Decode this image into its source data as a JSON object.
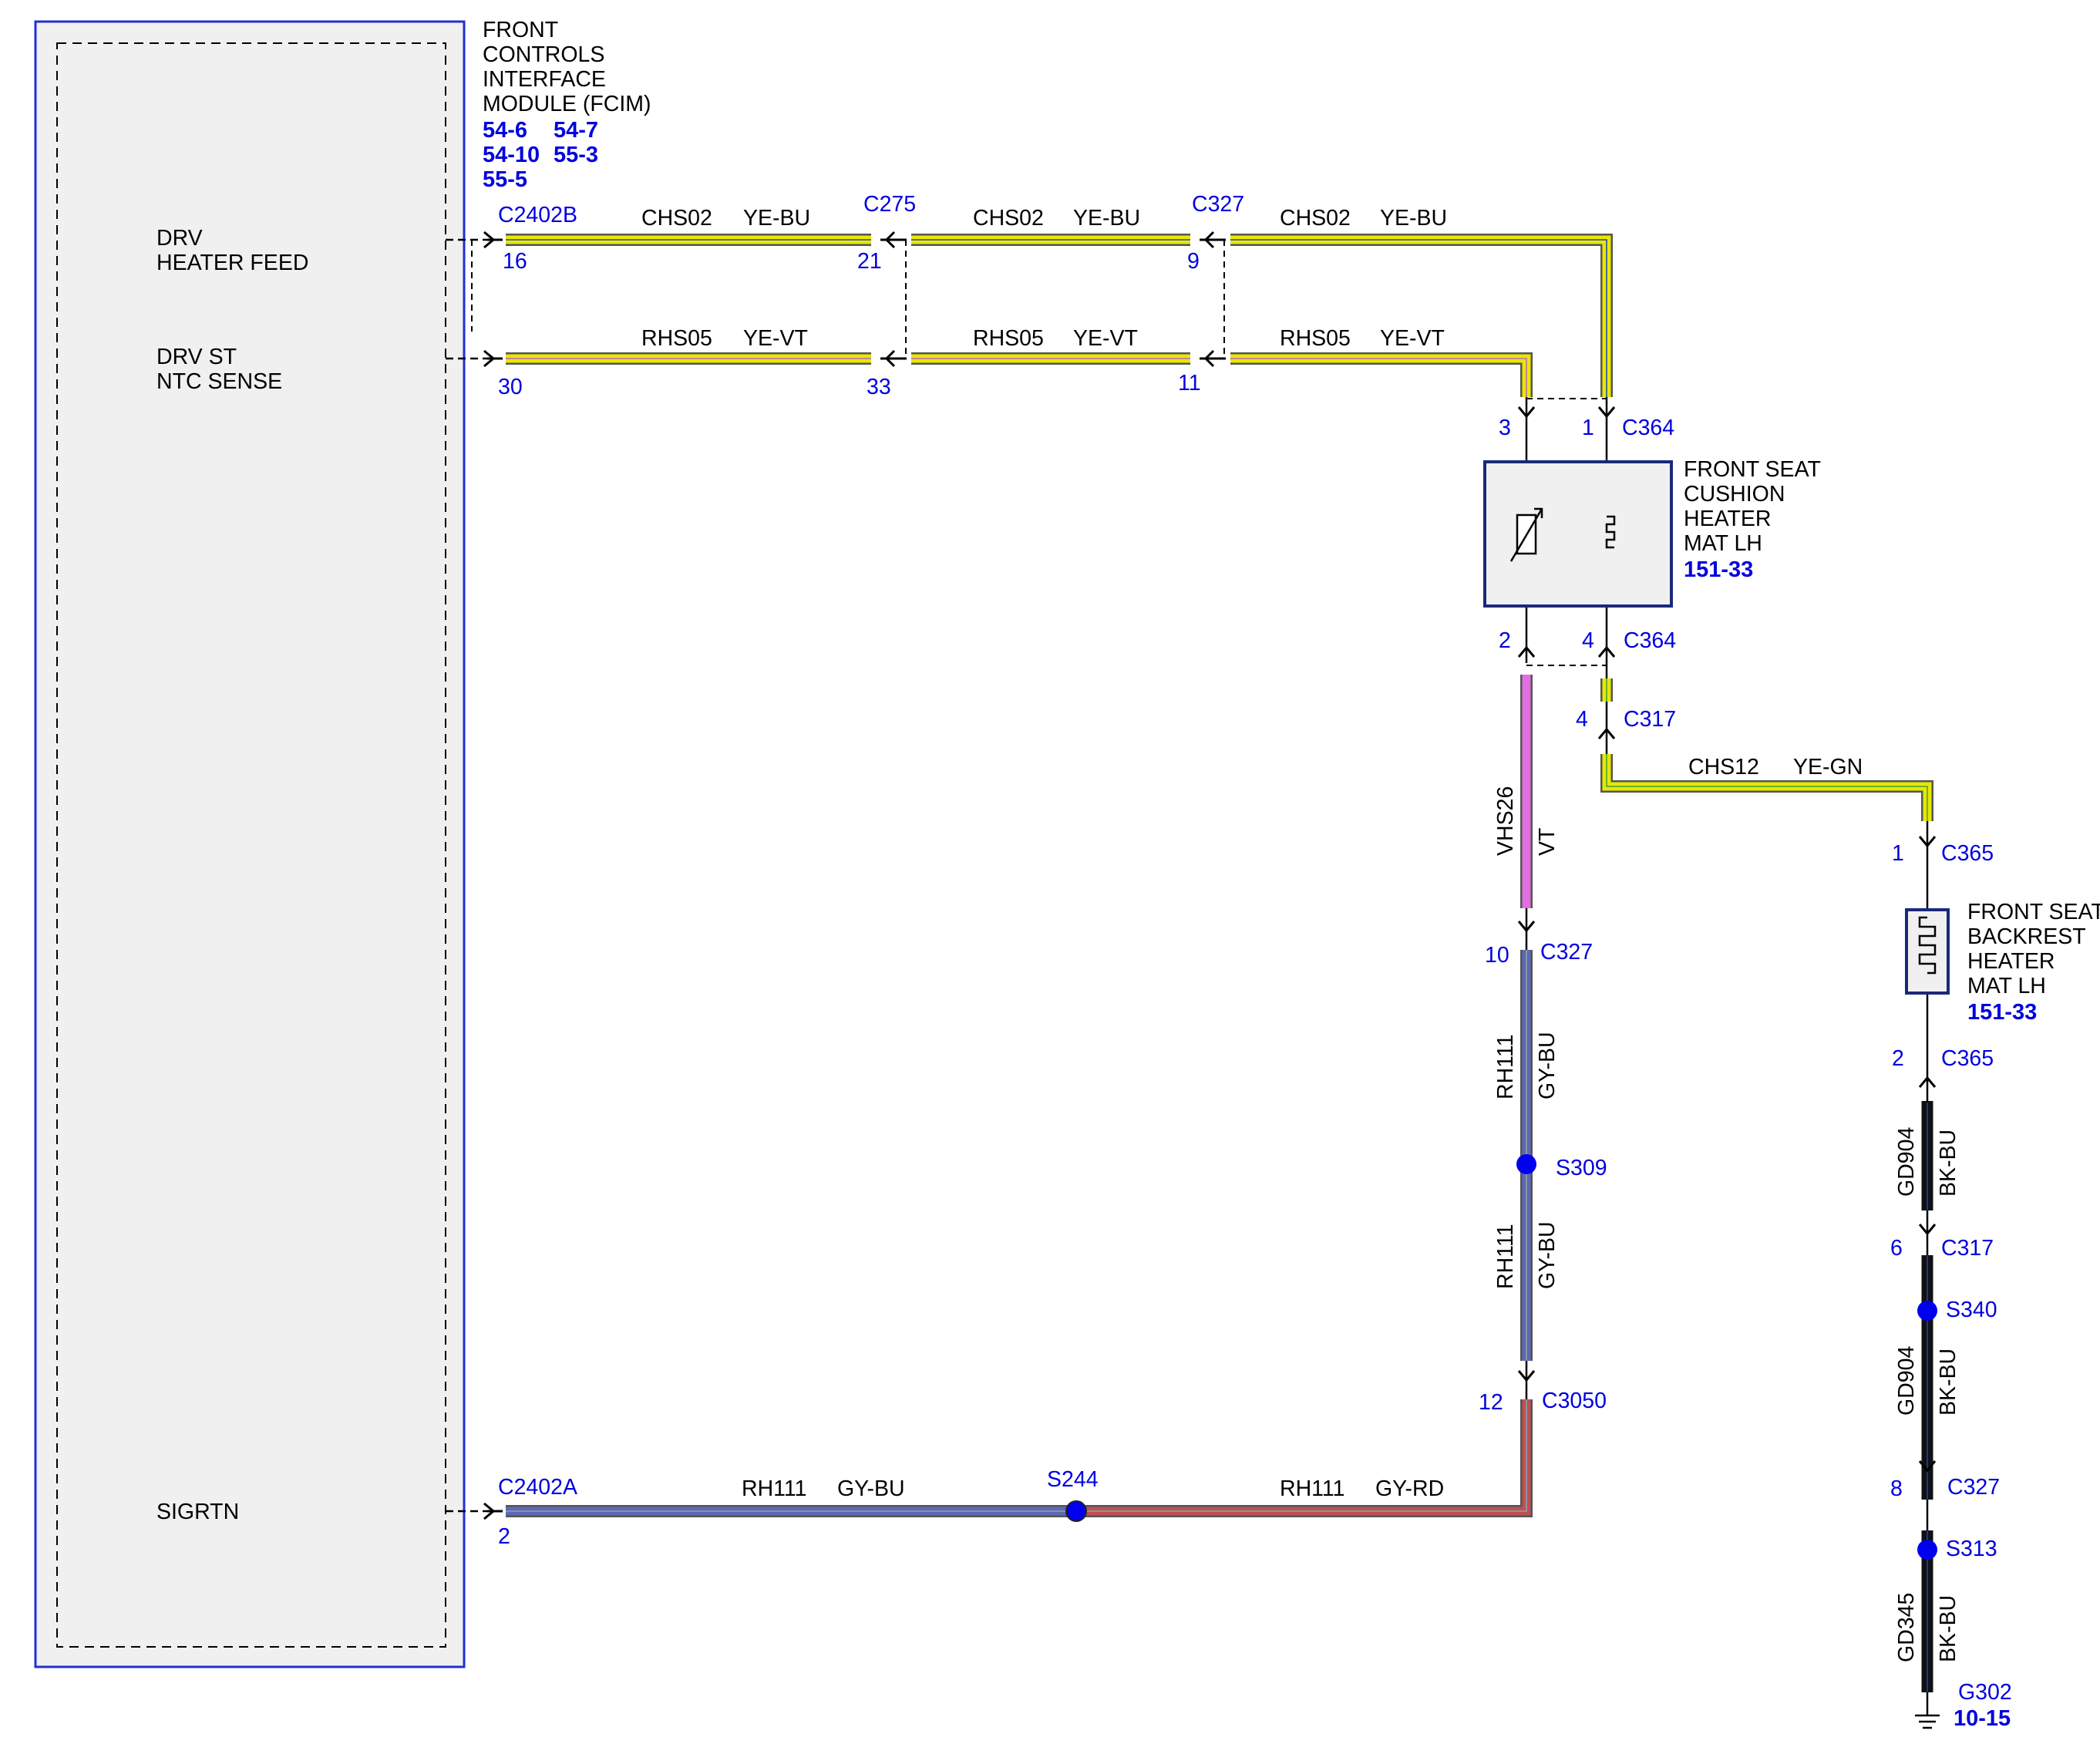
{
  "module": {
    "title_lines": [
      "FRONT",
      "CONTROLS",
      "INTERFACE",
      "MODULE (FCIM)"
    ],
    "refs": [
      "54-6",
      "54-7",
      "54-10",
      "55-3",
      "55-5"
    ],
    "pins": [
      {
        "label_lines": [
          "DRV",
          "HEATER FEED"
        ]
      },
      {
        "label_lines": [
          "DRV ST",
          "NTC SENSE"
        ]
      },
      {
        "label_lines": [
          "SIGRTN"
        ]
      }
    ]
  },
  "connectors": {
    "c2402b": "C2402B",
    "c2402a": "C2402A",
    "c275": "C275",
    "c327_top": "C327",
    "c364_top": "C364",
    "c364_bottom": "C364",
    "c317_top": "C317",
    "c365_top": "C365",
    "c365_bottom": "C365",
    "c327_mid": "C327",
    "c3050": "C3050",
    "c317_right": "C317",
    "c327_right": "C327",
    "g302": "G302"
  },
  "pin_numbers": {
    "c2402b_16": "16",
    "c2402b_30": "30",
    "c2402a_2": "2",
    "c275_21": "21",
    "c275_33": "33",
    "c327_9": "9",
    "c327_11": "11",
    "c364_3": "3",
    "c364_1": "1",
    "c364_2": "2",
    "c364_4": "4",
    "c317_4": "4",
    "c365_1": "1",
    "c365_2": "2",
    "c327_10": "10",
    "c3050_12": "12",
    "c317_6": "6",
    "c327_8": "8"
  },
  "splices": {
    "s309": "S309",
    "s244": "S244",
    "s340": "S340",
    "s313": "S313"
  },
  "circuits": {
    "chs02": "CHS02",
    "ye_bu": "YE-BU",
    "rhs05": "RHS05",
    "ye_vt": "YE-VT",
    "chs12": "CHS12",
    "ye_gn": "YE-GN",
    "vhs26": "VHS26",
    "vt": "VT",
    "rh111": "RH111",
    "gy_bu": "GY-BU",
    "gy_rd": "GY-RD",
    "gd904": "GD904",
    "bk_bu": "BK-BU",
    "gd345": "GD345"
  },
  "components": {
    "cushion": {
      "lines": [
        "FRONT SEAT",
        "CUSHION",
        "HEATER",
        "MAT LH"
      ],
      "ref": "151-33"
    },
    "backrest": {
      "lines": [
        "FRONT SEAT",
        "BACKREST",
        "HEATER",
        "MAT LH"
      ],
      "ref": "151-33"
    },
    "ground_ref": "10-15"
  },
  "colors": {
    "yellow": "#e8e800",
    "violet": "#e070e0",
    "gray_blue": "#5a6ab8",
    "gray_red": "#c05050",
    "black": "#111111",
    "label_blue": "#0000e0",
    "module_border": "#2030d0",
    "component_fill": "#f0f0f0"
  }
}
